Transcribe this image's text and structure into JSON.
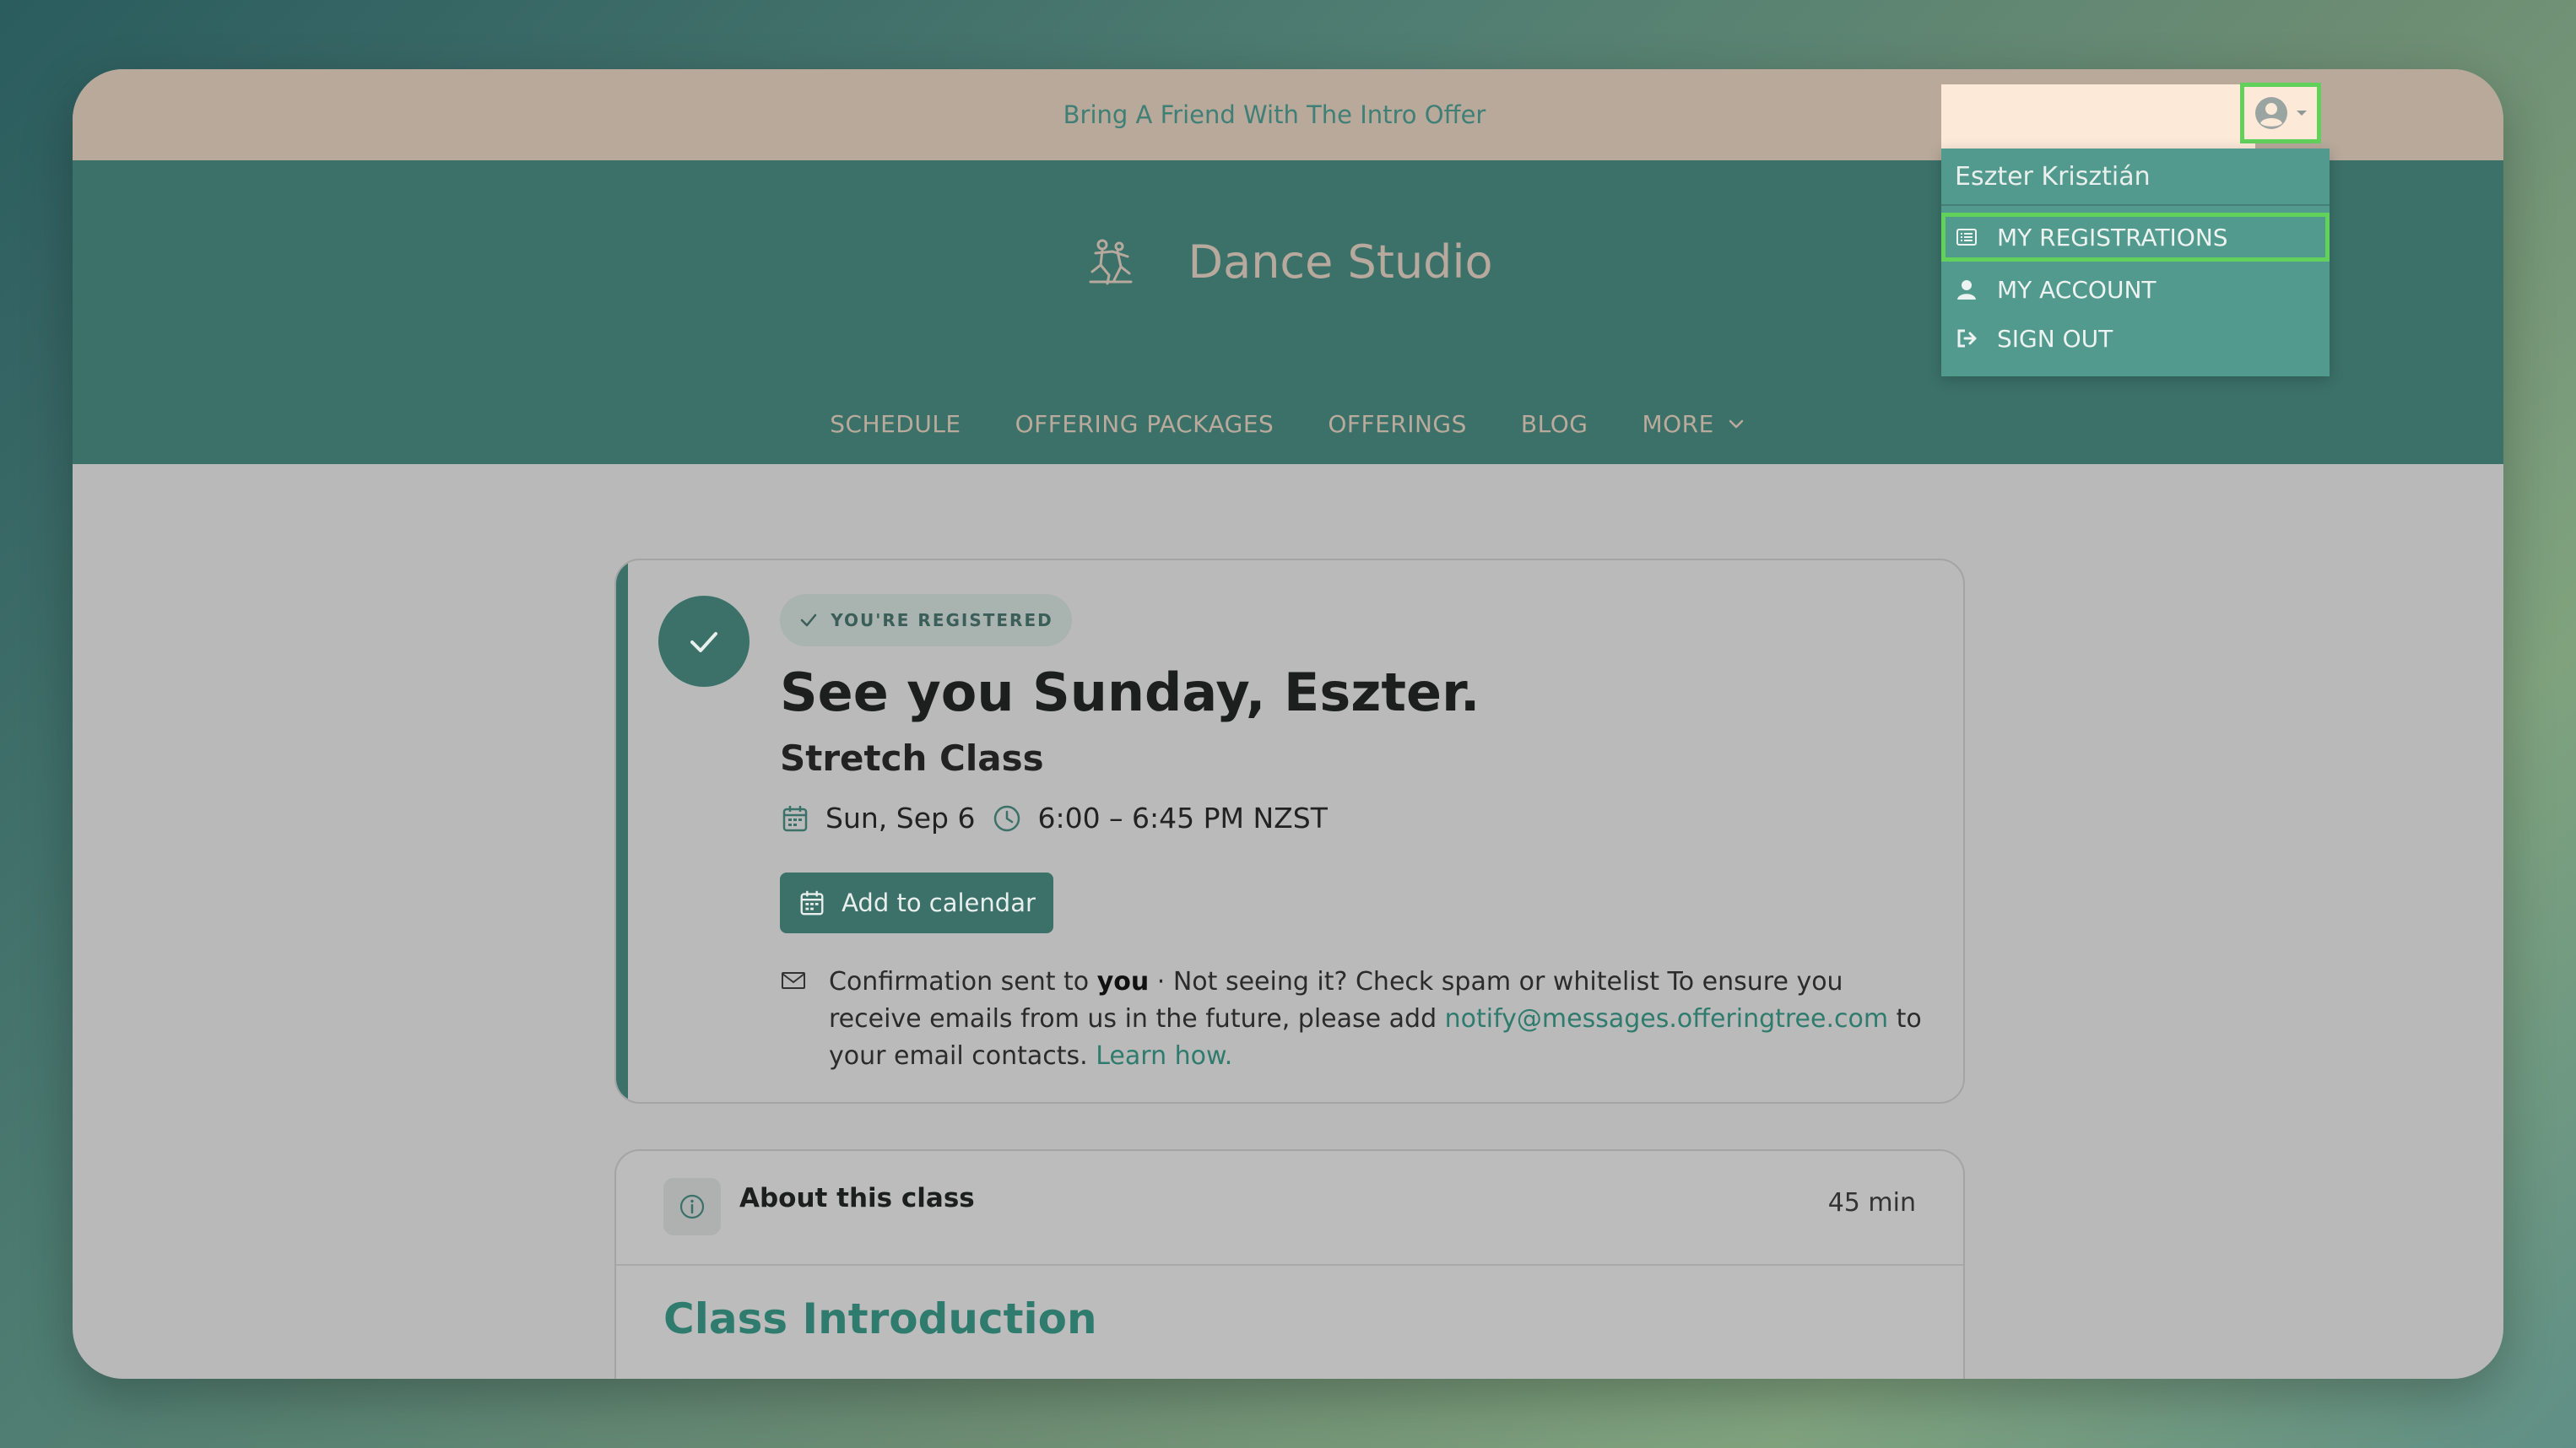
{
  "promo": {
    "text": "Bring A Friend With The Intro Offer"
  },
  "brand": {
    "name": "Dance Studio",
    "logo_icon": "dancers-logo-icon"
  },
  "nav": {
    "items": [
      "SCHEDULE",
      "OFFERING PACKAGES",
      "OFFERINGS",
      "BLOG",
      "MORE"
    ]
  },
  "account_menu": {
    "user_name": "Eszter Krisztián",
    "items": [
      {
        "label": "MY REGISTRATIONS",
        "icon": "list-icon",
        "selected": true
      },
      {
        "label": "MY ACCOUNT",
        "icon": "user-icon",
        "selected": false
      },
      {
        "label": "SIGN OUT",
        "icon": "sign-out-icon",
        "selected": false
      }
    ]
  },
  "registration": {
    "badge": "YOU'RE REGISTERED",
    "headline": "See you Sunday, Eszter.",
    "class_name": "Stretch Class",
    "date": "Sun, Sep 6",
    "time": "6:00 – 6:45 PM NZST",
    "add_to_calendar": "Add to calendar",
    "confirm_prefix": "Confirmation sent to",
    "confirm_target": "you",
    "confirm_mid": "· Not seeing it? Check spam or whitelist To ensure you receive emails from us in the future, please add",
    "confirm_email": "notify@messages.offeringtree.com",
    "confirm_suffix": "to your email contacts.",
    "learn_how": "Learn how."
  },
  "about": {
    "title": "About this class",
    "duration": "45 min",
    "intro_title": "Class Introduction"
  },
  "colors": {
    "brand": "#3b7169",
    "promo_bar": "#b8a99b",
    "highlight": "#62d15c",
    "dropdown": "#519a8d",
    "link": "#2f7b6e"
  }
}
